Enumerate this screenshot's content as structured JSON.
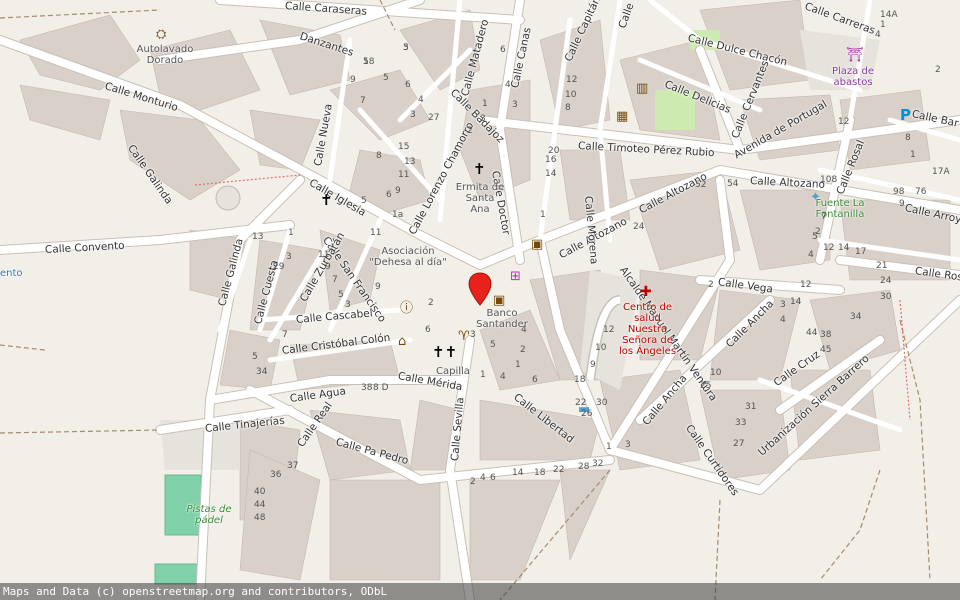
{
  "streets": [
    "Calle Monturio",
    "Danzantes",
    "Calle Galinda",
    "Calle Iglesia",
    "Calle Nueva",
    "Calle Matadero",
    "Calle Canas",
    "Calle Capitán",
    "Calle Badajoz",
    "Calle Lorenzo Chamorro",
    "Calle Doctor",
    "Calle Timoteo Pérez Rubio",
    "Calle Dulce Chacón",
    "Calle Delicias",
    "Calle Cervantes",
    "Avenida de Portugal",
    "Calle Altozano",
    "Calle Morena",
    "Calle Convento",
    "Calle San Francisco",
    "Calle Zurbarán",
    "Calle Cuesta",
    "Calle Galinda",
    "Calle Cascabel",
    "Calle Cristóbal Colón",
    "Calle Mérida",
    "Calle Agua",
    "Calle Tinajerías",
    "Calle Real",
    "Calle Pa Pedro",
    "Calle Sevilla",
    "Calle Libertad",
    "Alcalde Manuel Martín Ventura",
    "Calle Vega",
    "Calle Ancha",
    "Calle Ancha",
    "Calle Cruz",
    "Calle Curtidores",
    "Urbanización Sierra Barrero",
    "Calle Rosal",
    "Calle Altozano",
    "Calle Arroy",
    "Calle Ros",
    "Calle Bar",
    "Calle Carreras",
    "Calle del P",
    "Calle Altozano",
    "Calle Caraseras"
  ],
  "pois": {
    "car_wash": "Autolavado Dorado",
    "chapel": "Ermita de Santa Ana",
    "association": "Asociación \"Dehesa al día\"",
    "bank": "Banco Santander",
    "church": "Capilla",
    "health": "Centro de salud Nuestra Señora de los Ángeles",
    "market": "Plaza de abastos",
    "fountain": "Fuente La Fontanilla",
    "padel": "Pistas de pádel",
    "left_edge": "ento"
  },
  "house_numbers": [
    "5",
    "18",
    "9",
    "7",
    "5",
    "6",
    "4",
    "3",
    "27",
    "15",
    "13",
    "11",
    "9",
    "6",
    "2",
    "3",
    "1",
    "12",
    "10",
    "8",
    "16",
    "14",
    "20",
    "6",
    "4",
    "3",
    "1",
    "11",
    "9",
    "7",
    "5",
    "3",
    "13",
    "1",
    "3",
    "5",
    "8",
    "11",
    "1a",
    "9",
    "7",
    "29",
    "5",
    "34",
    "38",
    "8 D",
    "6",
    "2",
    "1",
    "3",
    "5",
    "4",
    "2",
    "1",
    "4",
    "6",
    "9",
    "10",
    "12",
    "18",
    "22",
    "26",
    "30",
    "1",
    "3",
    "2",
    "4",
    "6",
    "14",
    "18",
    "22",
    "28",
    "32",
    "36",
    "37",
    "40",
    "44",
    "48",
    "52",
    "54",
    "24",
    "2",
    "4",
    "12",
    "14",
    "17",
    "21",
    "24",
    "30",
    "34",
    "38",
    "45",
    "44",
    "33",
    "31",
    "27",
    "12",
    "14",
    "10",
    "25",
    "108",
    "98",
    "76",
    "2",
    "3",
    "4",
    "5",
    "7",
    "9",
    "1",
    "12",
    "17A",
    "8",
    "4",
    "1",
    "14A",
    "2",
    "3",
    "5"
  ],
  "attribution": "Maps and Data (c) openstreetmap.org and contributors, ODbL",
  "colors": {
    "background": "#f2efe9",
    "building": "#d9d0c9",
    "road": "#ffffff",
    "road_casing": "#c9c0b6",
    "green": "#7fd1a9",
    "health": "#bf0000",
    "marker": "#e8221b"
  },
  "marker_icon": "map-pin-icon"
}
